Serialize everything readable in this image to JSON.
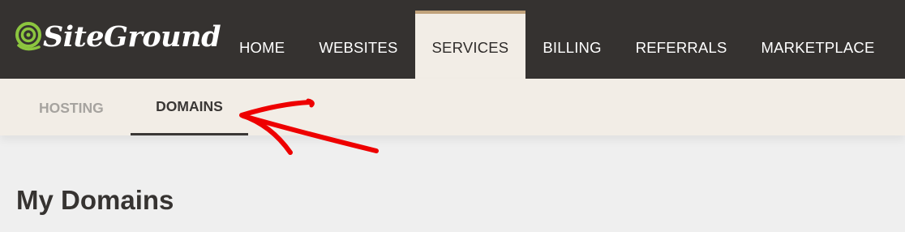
{
  "brand": {
    "name": "SiteGround",
    "accent": "#8cc63f"
  },
  "nav": {
    "items": [
      {
        "label": "HOME"
      },
      {
        "label": "WEBSITES"
      },
      {
        "label": "SERVICES"
      },
      {
        "label": "BILLING"
      },
      {
        "label": "REFERRALS"
      },
      {
        "label": "MARKETPLACE"
      }
    ],
    "active": "SERVICES"
  },
  "subnav": {
    "items": [
      {
        "label": "HOSTING"
      },
      {
        "label": "DOMAINS"
      }
    ],
    "active": "DOMAINS"
  },
  "page": {
    "title": "My Domains"
  },
  "annotation": {
    "arrow_color": "#ee0000",
    "points_to": "DOMAINS"
  }
}
